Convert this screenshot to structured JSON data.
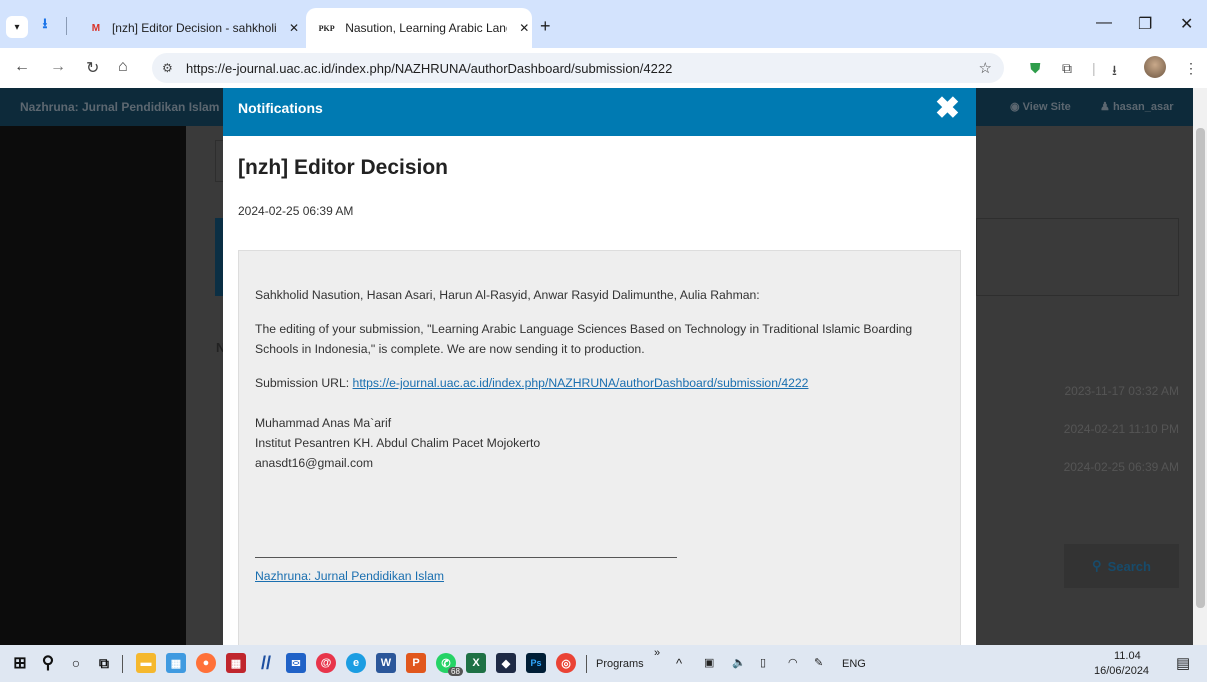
{
  "browser": {
    "tabs": [
      {
        "label": "[nzh] Editor Decision - sahkholi",
        "favicon": "gmail-icon"
      },
      {
        "label": "Nasution, Learning Arabic Lang",
        "favicon": "pkp-icon",
        "favicon_text": "PKP"
      }
    ],
    "url": "https://e-journal.uac.ac.id/index.php/NAZHRUNA/authorDashboard/submission/4222"
  },
  "page": {
    "site_title": "Nazhruna: Jurnal Pendidikan Islam",
    "view_site": "View Site",
    "user": "hasan_asar",
    "dates": [
      "2023-11-17 03:32 AM",
      "2024-02-21 11:10 PM",
      "2024-02-25 06:39 AM"
    ],
    "search_label": "Search",
    "partial_letter": "N"
  },
  "modal": {
    "header": "Notifications",
    "subject": "[nzh] Editor Decision",
    "date": "2024-02-25 06:39 AM",
    "body": {
      "salutation": "Sahkholid Nasution, Hasan Asari, Harun Al-Rasyid, Anwar Rasyid Dalimunthe, Aulia Rahman:",
      "paragraph": "The editing of your submission, \"Learning Arabic Language Sciences Based on Technology in Traditional Islamic Boarding Schools in Indonesia,\" is complete. We are now sending it to production.",
      "url_label": "Submission URL:",
      "url_link": "https://e-journal.uac.ac.id/index.php/NAZHRUNA/authorDashboard/submission/4222",
      "signature_name": "Muhammad Anas Ma`arif",
      "signature_institution": "Institut Pesantren KH. Abdul Chalim Pacet Mojokerto",
      "signature_email": "anasdt16@gmail.com",
      "footer_link": "Nazhruna: Jurnal Pendidikan Islam"
    }
  },
  "taskbar": {
    "programs_label": "Programs",
    "chevron": "»",
    "whatsapp_badge": "68",
    "lang": "ENG",
    "time": "11.04",
    "date": "16/06/2024"
  }
}
